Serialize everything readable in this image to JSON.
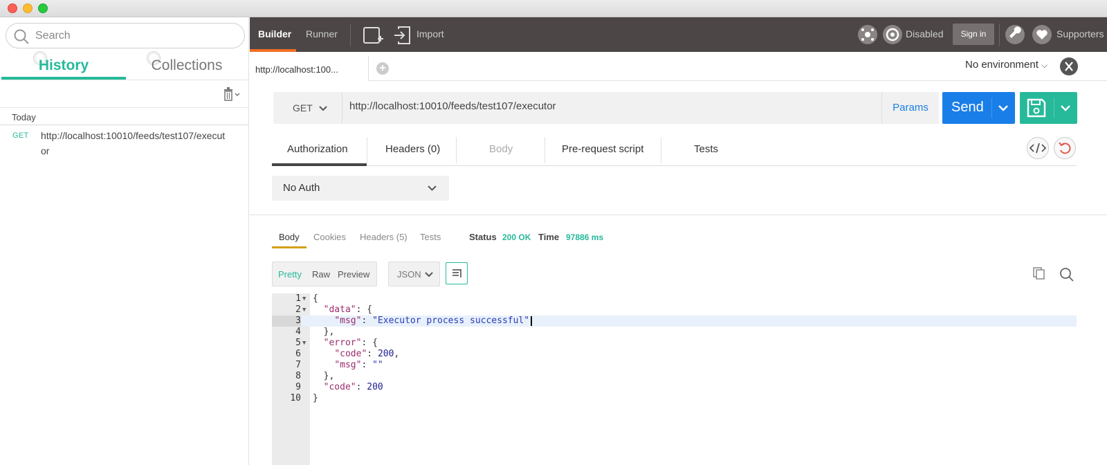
{
  "sidebar": {
    "search_placeholder": "Search",
    "tabs": [
      {
        "label": "History"
      },
      {
        "label": "Collections"
      }
    ],
    "section_label": "Today",
    "history": [
      {
        "method": "GET",
        "url": "http://localhost:10010/feeds/test107/executor"
      }
    ]
  },
  "topbar": {
    "builder": "Builder",
    "runner": "Runner",
    "import": "Import",
    "disabled": "Disabled",
    "sign_in": "Sign in",
    "supporters": "Supporters"
  },
  "request_tab": {
    "title": "http://localhost:100..."
  },
  "environment": {
    "selected": "No environment"
  },
  "request": {
    "method": "GET",
    "url": "http://localhost:10010/feeds/test107/executor",
    "params_label": "Params",
    "send_label": "Send",
    "tabs": {
      "authorization": "Authorization",
      "headers": "Headers (0)",
      "body": "Body",
      "prerequest": "Pre-request script",
      "tests": "Tests"
    },
    "auth_type": "No Auth"
  },
  "response": {
    "tabs": {
      "body": "Body",
      "cookies": "Cookies",
      "headers": "Headers (5)",
      "tests": "Tests"
    },
    "status_label": "Status",
    "status_value": "200 OK",
    "time_label": "Time",
    "time_value": "97886 ms",
    "formats": {
      "pretty": "Pretty",
      "raw": "Raw",
      "preview": "Preview"
    },
    "language": "JSON",
    "code_lines": [
      "1",
      "2",
      "3",
      "4",
      "5",
      "6",
      "7",
      "8",
      "9",
      "10"
    ]
  },
  "colors": {
    "accent_teal": "#26b99a",
    "send_blue": "#1a7ee8",
    "topbar_bg": "#4c4646",
    "builder_orange": "#f47023"
  }
}
